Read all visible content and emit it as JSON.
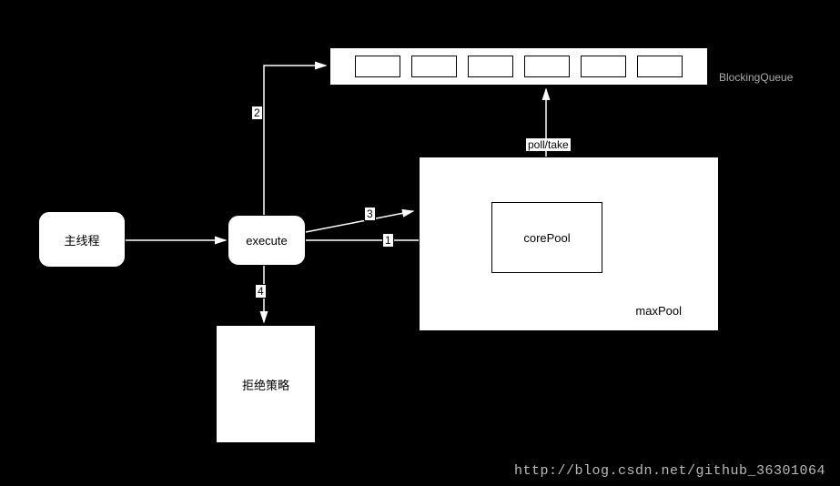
{
  "nodes": {
    "main_thread": "主线程",
    "execute": "execute",
    "reject_policy": "拒绝策略",
    "core_pool": "corePool",
    "max_pool": "maxPool",
    "blocking_queue": "BlockingQueue"
  },
  "edges": {
    "e2": "2",
    "e3": "3",
    "e1": "1",
    "e4": "4",
    "poll_take": "poll/take"
  },
  "queue_slots": 6,
  "watermark": "http://blog.csdn.net/github_36301064"
}
